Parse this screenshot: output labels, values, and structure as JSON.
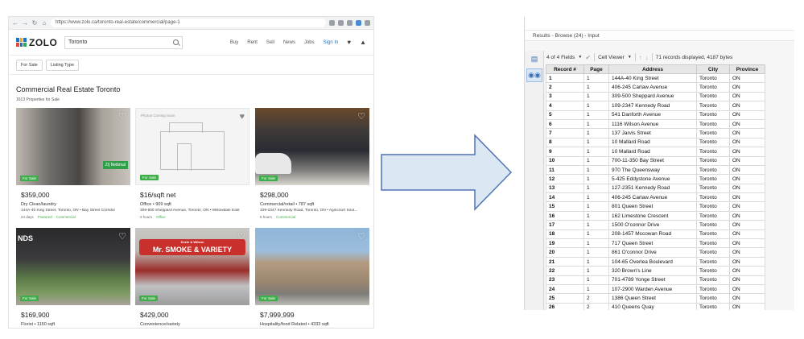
{
  "browser": {
    "url": "https://www.zolo.ca/toronto-real-estate/commercial/page-1",
    "logo_text": "ZOLO",
    "search_value": "Toronto",
    "nav": [
      "Buy",
      "Rent",
      "Sell",
      "News",
      "Jobs",
      "Sign In"
    ],
    "filters": [
      "For Sale",
      "Listing Type"
    ],
    "page_title": "Commercial Real Estate Toronto",
    "count_text": "1613 Properties for Sale",
    "listings": [
      {
        "badge": "For Sale",
        "price": "$359,000",
        "type": "Dry Clean/laundry",
        "address": "144A-40 King Street, Toronto, ON • Bay Street Corridor",
        "meta": [
          "24 days",
          "Featured",
          "Commercial"
        ],
        "photo_sign": "Z/j Netkmal"
      },
      {
        "badge": "For Sale",
        "price": "$16/sqft net",
        "type": "Office • 909 sqft",
        "address": "309-500 Sheppard Avenue, Toronto, ON • Willowdale East",
        "meta": [
          "2 hours",
          "Office"
        ],
        "photo_note": "Photos Coming Soon"
      },
      {
        "badge": "For Sale",
        "price": "$298,000",
        "type": "Commercial/retail • 787 sqft",
        "address": "109-2347 Kennedy Road, Toronto, ON • Agincourt Sout...",
        "meta": [
          "5 hours",
          "Commercial"
        ]
      },
      {
        "badge": "For Sale",
        "price": "$169,900",
        "type": "Florist • 1150 sqft",
        "address": "",
        "meta": [],
        "photo_sign": "NDS"
      },
      {
        "badge": "For Sale",
        "price": "$429,000",
        "type": "Convenience/variety",
        "address": "",
        "meta": [],
        "photo_banner_small": "Keele & Wilson",
        "photo_banner": "Mr. SMOKE & VARIETY"
      },
      {
        "badge": "For Sale",
        "price": "$7,999,999",
        "type": "Hospitality/food Related • 4333 sqft",
        "address": "",
        "meta": []
      }
    ]
  },
  "results": {
    "window_title": "Results - Browse (24) - Input",
    "fields_selector": "4 of 4 Fields",
    "cell_viewer": "Cell Viewer",
    "status": "71 records displayed, 4187 bytes",
    "columns": [
      "Record #",
      "Page",
      "Address",
      "City",
      "Province"
    ],
    "rows": [
      [
        "1",
        "1",
        "144A-40 King Street",
        "Toronto",
        "ON"
      ],
      [
        "2",
        "1",
        "406-245 Carlaw Avenue",
        "Toronto",
        "ON"
      ],
      [
        "3",
        "1",
        "309-500 Sheppard Avenue",
        "Toronto",
        "ON"
      ],
      [
        "4",
        "1",
        "109-2347 Kennedy Road",
        "Toronto",
        "ON"
      ],
      [
        "5",
        "1",
        "541 Danforth Avenue",
        "Toronto",
        "ON"
      ],
      [
        "6",
        "1",
        "1116 Wilson Avenue",
        "Toronto",
        "ON"
      ],
      [
        "7",
        "1",
        "137 Jarvis Street",
        "Toronto",
        "ON"
      ],
      [
        "8",
        "1",
        "10 Mallard Road",
        "Toronto",
        "ON"
      ],
      [
        "9",
        "1",
        "10 Mallard Road",
        "Toronto",
        "ON"
      ],
      [
        "10",
        "1",
        "700-11-350 Bay Street",
        "Toronto",
        "ON"
      ],
      [
        "11",
        "1",
        "970 The Queensway",
        "Toronto",
        "ON"
      ],
      [
        "12",
        "1",
        "5-425 Eddystone Avenue",
        "Toronto",
        "ON"
      ],
      [
        "13",
        "1",
        "127-2351 Kennedy Road",
        "Toronto",
        "ON"
      ],
      [
        "14",
        "1",
        "406-245 Carlaw Avenue",
        "Toronto",
        "ON"
      ],
      [
        "15",
        "1",
        "801 Queen Street",
        "Toronto",
        "ON"
      ],
      [
        "16",
        "1",
        "162 Limestone Crescent",
        "Toronto",
        "ON"
      ],
      [
        "17",
        "1",
        "1500 O'connor Drive",
        "Toronto",
        "ON"
      ],
      [
        "18",
        "1",
        "208-1457 Mccowan Road",
        "Toronto",
        "ON"
      ],
      [
        "19",
        "1",
        "717 Queen Street",
        "Toronto",
        "ON"
      ],
      [
        "20",
        "1",
        "861 O'connor Drive",
        "Toronto",
        "ON"
      ],
      [
        "21",
        "1",
        "104-65 Overlea Boulevard",
        "Toronto",
        "ON"
      ],
      [
        "22",
        "1",
        "320 Brown's Line",
        "Toronto",
        "ON"
      ],
      [
        "23",
        "1",
        "701-4789 Yonge Street",
        "Toronto",
        "ON"
      ],
      [
        "24",
        "1",
        "107-2900 Warden Avenue",
        "Toronto",
        "ON"
      ],
      [
        "25",
        "2",
        "1386 Queen Street",
        "Toronto",
        "ON"
      ],
      [
        "26",
        "2",
        "410 Queens Quay",
        "Toronto",
        "ON"
      ]
    ]
  },
  "colors": {
    "zolo_blue": "#1b73c9",
    "for_sale_green": "#3fae4a",
    "arrow_fill": "#dce7f4",
    "arrow_stroke": "#4f74b3",
    "table_header": "#e6e6e6"
  },
  "icons": [
    "back-icon",
    "forward-icon",
    "reload-icon",
    "home-icon",
    "search-icon",
    "heart-icon",
    "bell-icon",
    "check-icon",
    "up-arrow-icon",
    "down-arrow-icon",
    "table-icon",
    "binoculars-icon"
  ]
}
